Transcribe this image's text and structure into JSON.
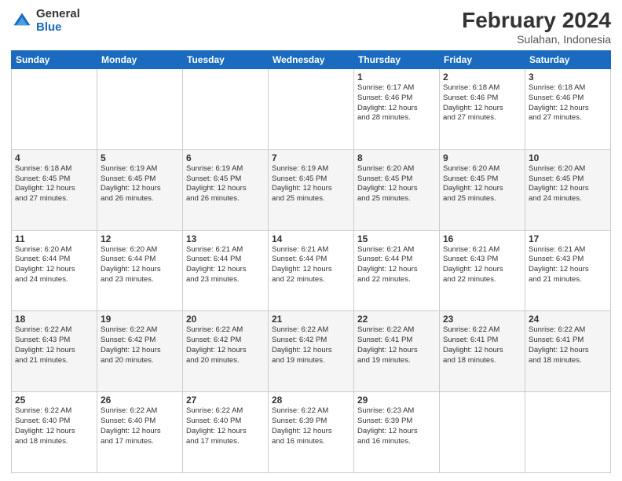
{
  "header": {
    "logo_general": "General",
    "logo_blue": "Blue",
    "title": "February 2024",
    "location": "Sulahan, Indonesia"
  },
  "days_of_week": [
    "Sunday",
    "Monday",
    "Tuesday",
    "Wednesday",
    "Thursday",
    "Friday",
    "Saturday"
  ],
  "weeks": [
    [
      {
        "day": "",
        "detail": ""
      },
      {
        "day": "",
        "detail": ""
      },
      {
        "day": "",
        "detail": ""
      },
      {
        "day": "",
        "detail": ""
      },
      {
        "day": "1",
        "detail": "Sunrise: 6:17 AM\nSunset: 6:46 PM\nDaylight: 12 hours\nand 28 minutes."
      },
      {
        "day": "2",
        "detail": "Sunrise: 6:18 AM\nSunset: 6:46 PM\nDaylight: 12 hours\nand 27 minutes."
      },
      {
        "day": "3",
        "detail": "Sunrise: 6:18 AM\nSunset: 6:46 PM\nDaylight: 12 hours\nand 27 minutes."
      }
    ],
    [
      {
        "day": "4",
        "detail": "Sunrise: 6:18 AM\nSunset: 6:45 PM\nDaylight: 12 hours\nand 27 minutes."
      },
      {
        "day": "5",
        "detail": "Sunrise: 6:19 AM\nSunset: 6:45 PM\nDaylight: 12 hours\nand 26 minutes."
      },
      {
        "day": "6",
        "detail": "Sunrise: 6:19 AM\nSunset: 6:45 PM\nDaylight: 12 hours\nand 26 minutes."
      },
      {
        "day": "7",
        "detail": "Sunrise: 6:19 AM\nSunset: 6:45 PM\nDaylight: 12 hours\nand 25 minutes."
      },
      {
        "day": "8",
        "detail": "Sunrise: 6:20 AM\nSunset: 6:45 PM\nDaylight: 12 hours\nand 25 minutes."
      },
      {
        "day": "9",
        "detail": "Sunrise: 6:20 AM\nSunset: 6:45 PM\nDaylight: 12 hours\nand 25 minutes."
      },
      {
        "day": "10",
        "detail": "Sunrise: 6:20 AM\nSunset: 6:45 PM\nDaylight: 12 hours\nand 24 minutes."
      }
    ],
    [
      {
        "day": "11",
        "detail": "Sunrise: 6:20 AM\nSunset: 6:44 PM\nDaylight: 12 hours\nand 24 minutes."
      },
      {
        "day": "12",
        "detail": "Sunrise: 6:20 AM\nSunset: 6:44 PM\nDaylight: 12 hours\nand 23 minutes."
      },
      {
        "day": "13",
        "detail": "Sunrise: 6:21 AM\nSunset: 6:44 PM\nDaylight: 12 hours\nand 23 minutes."
      },
      {
        "day": "14",
        "detail": "Sunrise: 6:21 AM\nSunset: 6:44 PM\nDaylight: 12 hours\nand 22 minutes."
      },
      {
        "day": "15",
        "detail": "Sunrise: 6:21 AM\nSunset: 6:44 PM\nDaylight: 12 hours\nand 22 minutes."
      },
      {
        "day": "16",
        "detail": "Sunrise: 6:21 AM\nSunset: 6:43 PM\nDaylight: 12 hours\nand 22 minutes."
      },
      {
        "day": "17",
        "detail": "Sunrise: 6:21 AM\nSunset: 6:43 PM\nDaylight: 12 hours\nand 21 minutes."
      }
    ],
    [
      {
        "day": "18",
        "detail": "Sunrise: 6:22 AM\nSunset: 6:43 PM\nDaylight: 12 hours\nand 21 minutes."
      },
      {
        "day": "19",
        "detail": "Sunrise: 6:22 AM\nSunset: 6:42 PM\nDaylight: 12 hours\nand 20 minutes."
      },
      {
        "day": "20",
        "detail": "Sunrise: 6:22 AM\nSunset: 6:42 PM\nDaylight: 12 hours\nand 20 minutes."
      },
      {
        "day": "21",
        "detail": "Sunrise: 6:22 AM\nSunset: 6:42 PM\nDaylight: 12 hours\nand 19 minutes."
      },
      {
        "day": "22",
        "detail": "Sunrise: 6:22 AM\nSunset: 6:41 PM\nDaylight: 12 hours\nand 19 minutes."
      },
      {
        "day": "23",
        "detail": "Sunrise: 6:22 AM\nSunset: 6:41 PM\nDaylight: 12 hours\nand 18 minutes."
      },
      {
        "day": "24",
        "detail": "Sunrise: 6:22 AM\nSunset: 6:41 PM\nDaylight: 12 hours\nand 18 minutes."
      }
    ],
    [
      {
        "day": "25",
        "detail": "Sunrise: 6:22 AM\nSunset: 6:40 PM\nDaylight: 12 hours\nand 18 minutes."
      },
      {
        "day": "26",
        "detail": "Sunrise: 6:22 AM\nSunset: 6:40 PM\nDaylight: 12 hours\nand 17 minutes."
      },
      {
        "day": "27",
        "detail": "Sunrise: 6:22 AM\nSunset: 6:40 PM\nDaylight: 12 hours\nand 17 minutes."
      },
      {
        "day": "28",
        "detail": "Sunrise: 6:22 AM\nSunset: 6:39 PM\nDaylight: 12 hours\nand 16 minutes."
      },
      {
        "day": "29",
        "detail": "Sunrise: 6:23 AM\nSunset: 6:39 PM\nDaylight: 12 hours\nand 16 minutes."
      },
      {
        "day": "",
        "detail": ""
      },
      {
        "day": "",
        "detail": ""
      }
    ]
  ]
}
